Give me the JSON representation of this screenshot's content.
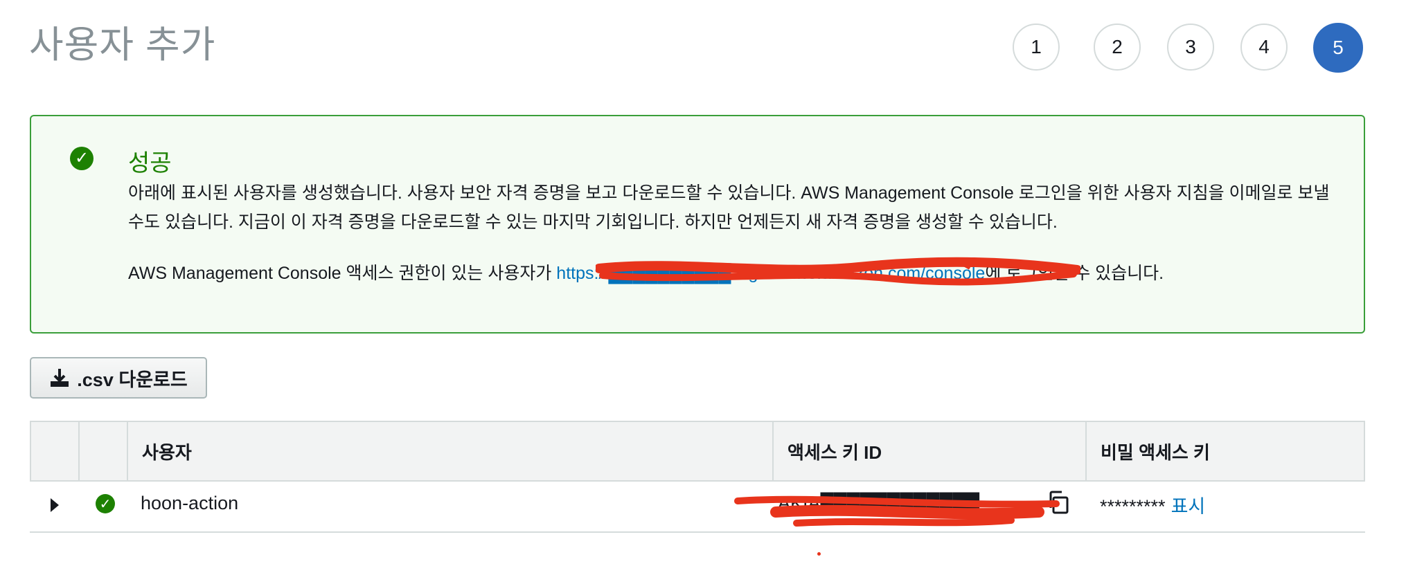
{
  "page": {
    "title": "사용자 추가"
  },
  "wizard": {
    "steps": [
      "1",
      "2",
      "3",
      "4",
      "5"
    ],
    "active_step": "5"
  },
  "alert": {
    "title": "성공",
    "text": "아래에 표시된 사용자를 생성했습니다. 사용자 보안 자격 증명을 보고 다운로드할 수 있습니다. AWS Management Console 로그인을 위한 사용자 지침을 이메일로 보낼 수도 있습니다. 지금이 이 자격 증명을 다운로드할 수 있는 마지막 기회입니다. 하지만 언제든지 새 자격 증명을 생성할 수 있습니다.",
    "login_prefix": "AWS Management Console 액세스 권한이 있는 사용자가 ",
    "login_link": "https://██████████.signin.aws.amazon.com/console",
    "login_suffix": "에 로그인할 수 있습니다."
  },
  "toolbar": {
    "csv_label": ".csv 다운로드"
  },
  "table": {
    "headers": {
      "user": "사용자",
      "access_key_id": "액세스 키 ID",
      "secret_key": "비밀 액세스 키"
    },
    "rows": [
      {
        "user": "hoon-action",
        "access_key_id": "AKIA████████████",
        "secret_masked": "*********",
        "show_label": "표시"
      }
    ]
  },
  "colors": {
    "success": "#1d8102",
    "link": "#0073bb",
    "active_step": "#2e6bbf",
    "redaction": "#e8341c"
  }
}
